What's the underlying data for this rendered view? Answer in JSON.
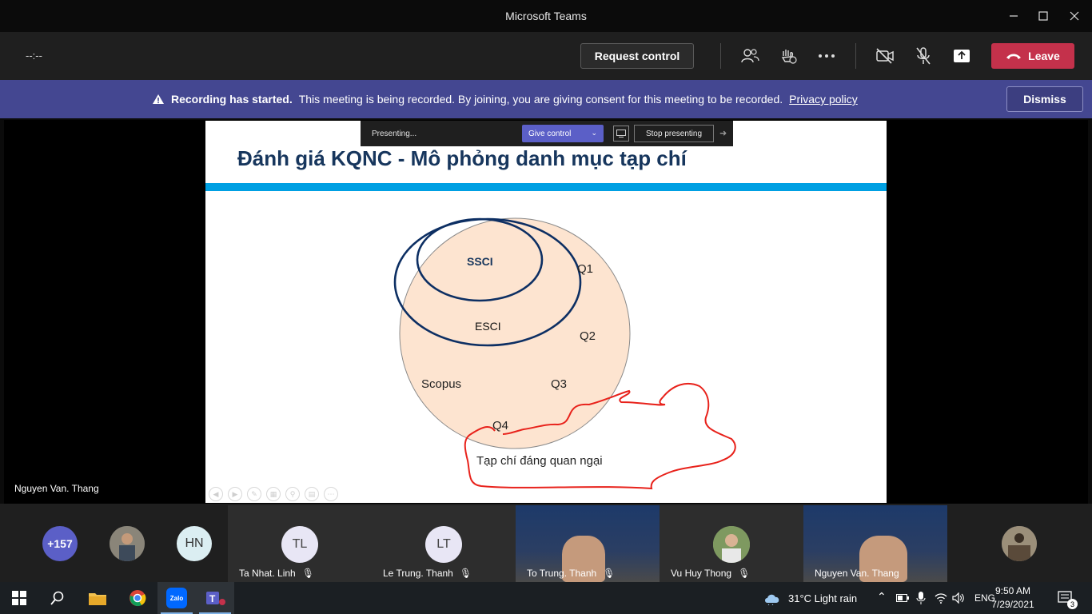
{
  "window": {
    "title": "Microsoft Teams"
  },
  "toolbar": {
    "timer": "--:--",
    "request_control": "Request control",
    "leave": "Leave",
    "icons": [
      "participants-icon",
      "reactions-icon",
      "more-icon",
      "camera-off-icon",
      "mic-off-icon",
      "share-icon"
    ]
  },
  "banner": {
    "bold": "Recording has started.",
    "text": "This meeting is being recorded. By joining, you are giving consent for this meeting to be recorded.",
    "link": "Privacy policy",
    "dismiss": "Dismiss"
  },
  "presenting_bar": {
    "status": "Presenting...",
    "give_control": "Give control",
    "stop": "Stop presenting"
  },
  "slide": {
    "title": "Đánh giá KQNC - Mô phỏng danh mục tạp chí",
    "labels": {
      "ssci": "SSCI",
      "q1": "Q1",
      "esci": "ESCI",
      "q2": "Q2",
      "scopus": "Scopus",
      "q3": "Q3",
      "q4": "Q4",
      "predatory": "Tạp chí đáng quan ngại"
    }
  },
  "stage": {
    "presenter": "Nguyen Van. Thang"
  },
  "participants": {
    "more_count": "+157",
    "hn": "HN",
    "tiles": [
      {
        "initials": "TL",
        "name": "Ta Nhat. Linh"
      },
      {
        "initials": "LT",
        "name": "Le Trung. Thanh"
      },
      {
        "name": "To Trung. Thanh"
      },
      {
        "name": "Vu Huy Thong"
      },
      {
        "name": "Nguyen Van. Thang"
      }
    ]
  },
  "taskbar": {
    "weather": "31°C  Light rain",
    "lang": "ENG",
    "time": "9:50 AM",
    "date": "7/29/2021",
    "notifications": "3",
    "zalo": "Zalo"
  },
  "colors": {
    "accent": "#5b5fc7",
    "banner": "#444791",
    "leave": "#c4314b",
    "slide_title": "#17365d",
    "slide_bar": "#00a0e3",
    "circle_fill": "#fde4d0",
    "ellipse_stroke": "#0d2f63",
    "ink": "#e8221b"
  }
}
